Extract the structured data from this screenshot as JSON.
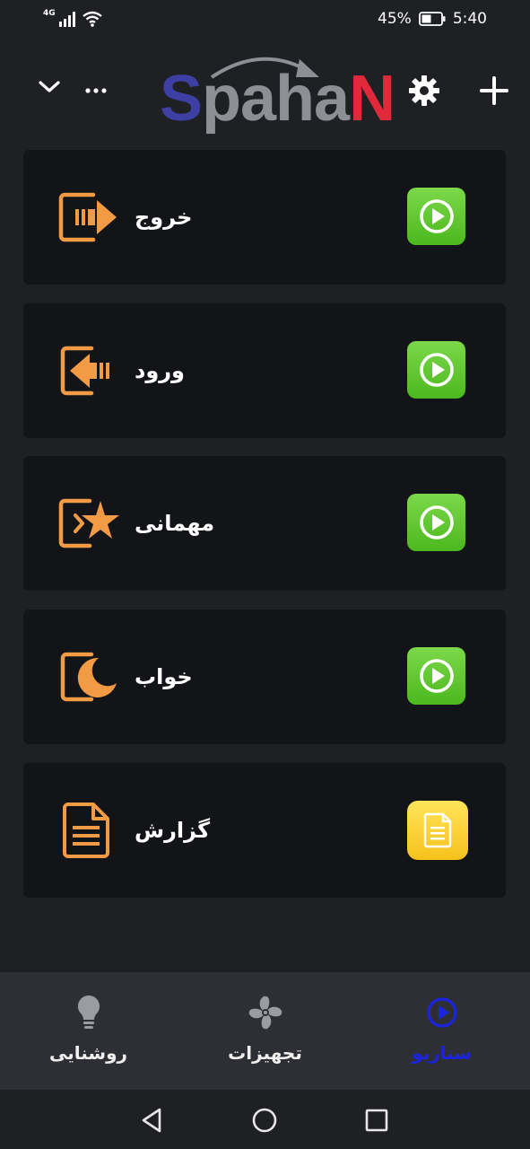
{
  "status_bar": {
    "network": "4G",
    "battery": "45%",
    "time": "5:40",
    "icons": [
      "signal-icon",
      "wifi-icon",
      "battery-icon"
    ]
  },
  "header": {
    "logo": {
      "part1": "S",
      "part2": "paha",
      "part3": "N"
    },
    "icons": [
      "chevron-down-icon",
      "more-icon",
      "gear-icon",
      "plus-icon"
    ]
  },
  "scenarios": [
    {
      "label": "خروج",
      "icon": "exit-icon",
      "action_icon": "play-icon"
    },
    {
      "label": "ورود",
      "icon": "enter-icon",
      "action_icon": "play-icon"
    },
    {
      "label": "مهمانی",
      "icon": "party-icon",
      "action_icon": "play-icon"
    },
    {
      "label": "خواب",
      "icon": "sleep-icon",
      "action_icon": "play-icon"
    },
    {
      "label": "گزارش",
      "icon": "report-icon",
      "action_icon": "document-icon"
    }
  ],
  "bottom_nav": {
    "items": [
      {
        "label": "روشنایی",
        "icon": "bulb-icon",
        "active": false
      },
      {
        "label": "تجهیزات",
        "icon": "fan-icon",
        "active": false
      },
      {
        "label": "سناریو",
        "icon": "play-circle-icon",
        "active": true
      }
    ]
  },
  "colors": {
    "background": "#1f2024",
    "card": "#131418",
    "accent_orange": "#f39a45",
    "play_green": "#5cc32b",
    "report_yellow": "#f8d02a",
    "active_nav": "#1a24e0"
  }
}
